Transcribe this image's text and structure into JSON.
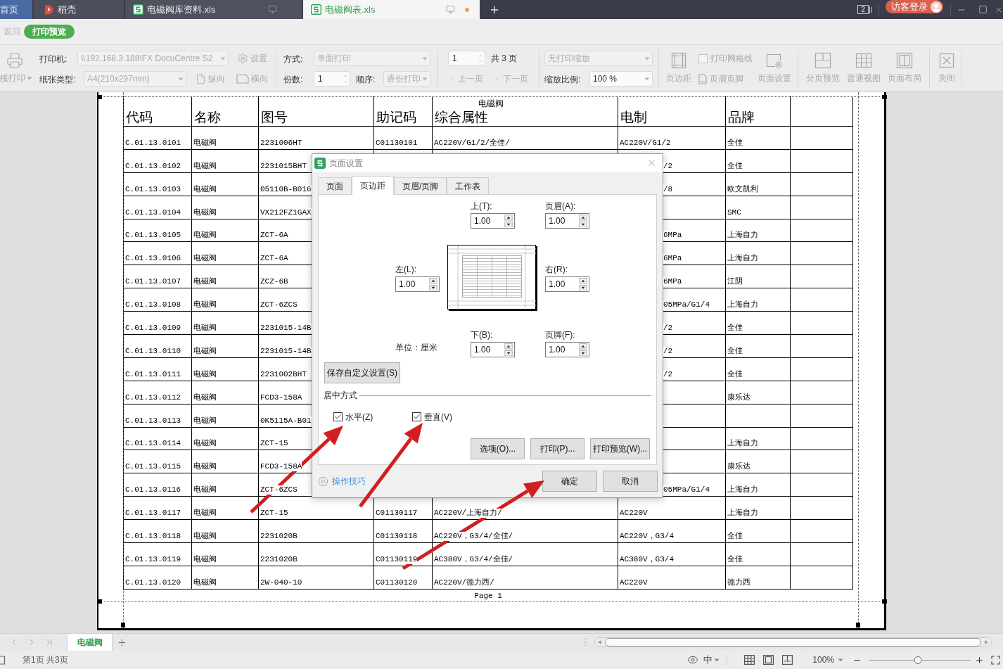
{
  "tabs": [
    {
      "label": "首页",
      "kind": "home",
      "selected": false
    },
    {
      "label": "稻壳",
      "kind": "docer",
      "selected": false
    },
    {
      "label": "电磁阀库资料.xls",
      "kind": "sheet",
      "selected": false,
      "unsaved": false
    },
    {
      "label": "电磁阀表.xls",
      "kind": "sheet",
      "selected": true,
      "unsaved": true
    }
  ],
  "title_bar": {
    "window_count": "2",
    "login_button": "访客登录"
  },
  "mode_bar": {
    "back": {
      "label": "返回",
      "disabled": true
    },
    "mode": "打印预览"
  },
  "toolbar": {
    "direct_print": {
      "label": "接打印",
      "disabled": true
    },
    "printer": {
      "label": "打印机:",
      "value": "\\\\192.168.3.188\\FX DocuCentre S2",
      "disabled": true
    },
    "printer_settings": {
      "label": "设置",
      "disabled": true
    },
    "paper": {
      "label": "纸张类型:",
      "value": "A4(210x297mm)",
      "disabled": true
    },
    "orientation": [
      {
        "label": "纵向",
        "kind": "portrait",
        "disabled": true
      },
      {
        "label": "横向",
        "kind": "landscape",
        "disabled": true
      }
    ],
    "duplex": {
      "label": "方式:",
      "value": "单面打印",
      "disabled": true
    },
    "copies": {
      "label": "份数:",
      "value": "1",
      "disabled": false
    },
    "collate": {
      "label": "顺序:",
      "value": "逐份打印",
      "disabled": true
    },
    "page": {
      "value": "1",
      "total": "共 3 页",
      "disabled": false
    },
    "page_nav": [
      {
        "label": "上一页",
        "kind": "prev",
        "disabled": true
      },
      {
        "label": "下一页",
        "kind": "next",
        "disabled": true
      }
    ],
    "scaling": {
      "value": "无打印缩放",
      "disabled": true
    },
    "zoom": {
      "label": "缩放比例:",
      "value": "100 %",
      "disabled": false
    },
    "margins_button": {
      "label": "页边距",
      "disabled": true
    },
    "gridlines": {
      "label": "打印网格线",
      "checked": false,
      "disabled": true
    },
    "header_footer_button": {
      "label": "页眉页脚",
      "disabled": true
    },
    "page_setup_button": {
      "label": "页面设置",
      "disabled": true
    },
    "views": [
      {
        "label": "分页预览",
        "kind": "page_break",
        "disabled": true
      },
      {
        "label": "普通视图",
        "kind": "normal",
        "disabled": true
      },
      {
        "label": "页面布局",
        "kind": "layout",
        "disabled": true
      }
    ],
    "close_button": {
      "label": "关闭",
      "disabled": true
    }
  },
  "page": {
    "header": "电磁阀",
    "footer": "Page 1",
    "columns": [
      "代码",
      "名称",
      "图号",
      "助记码",
      "综合属性",
      "电制",
      "品牌"
    ],
    "rows": [
      {
        "code": "C.01.13.0101",
        "name": "电磁阀",
        "part_no": "2231006HT",
        "mnemonic": "C01130101",
        "properties": "AC220V/G1/2/全佳/",
        "power": "AC220V/G1/2",
        "brand": "全佳"
      },
      {
        "code": "C.01.13.0102",
        "name": "电磁阀",
        "part_no": "2231015BHT",
        "power": "/2",
        "brand": "全佳"
      },
      {
        "code": "C.01.13.0103",
        "name": "电磁阀",
        "part_no": "05110B-B016",
        "power": "/8",
        "brand": "欧文凯利"
      },
      {
        "code": "C.01.13.0104",
        "name": "电磁阀",
        "part_no": "VX212FZ1GAX",
        "brand": "SMC"
      },
      {
        "code": "C.01.13.0105",
        "name": "电磁阀",
        "part_no": "ZCT-6A",
        "power": "6MPa",
        "brand": "上海自力"
      },
      {
        "code": "C.01.13.0106",
        "name": "电磁阀",
        "part_no": "ZCT-6A",
        "power": "6MPa",
        "brand": "上海自力"
      },
      {
        "code": "C.01.13.0107",
        "name": "电磁阀",
        "part_no": "ZCZ-6B",
        "power": "6MPa",
        "brand": "江阴"
      },
      {
        "code": "C.01.13.0108",
        "name": "电磁阀",
        "part_no": "ZCT-6ZCS",
        "power": "05MPa/G1/4",
        "brand": "上海自力"
      },
      {
        "code": "C.01.13.0109",
        "name": "电磁阀",
        "part_no": "2231015-14B",
        "power": "/2",
        "brand": "全佳"
      },
      {
        "code": "C.01.13.0110",
        "name": "电磁阀",
        "part_no": "2231015-14B",
        "power": "/2",
        "brand": "全佳"
      },
      {
        "code": "C.01.13.0111",
        "name": "电磁阀",
        "part_no": "2231002BHT",
        "power": "/2",
        "brand": "全佳"
      },
      {
        "code": "C.01.13.0112",
        "name": "电磁阀",
        "part_no": "FCD3-158A",
        "brand": "康乐达"
      },
      {
        "code": "C.01.13.0113",
        "name": "电磁阀",
        "part_no": "0K5115A-B01"
      },
      {
        "code": "C.01.13.0114",
        "name": "电磁阀",
        "part_no": "ZCT-15",
        "brand": "上海自力"
      },
      {
        "code": "C.01.13.0115",
        "name": "电磁阀",
        "part_no": "FCD3-158A",
        "brand": "康乐达"
      },
      {
        "code": "C.01.13.0116",
        "name": "电磁阀",
        "part_no": "ZCT-6ZCS",
        "power": "05MPa/G1/4",
        "brand": "上海自力"
      },
      {
        "code": "C.01.13.0117",
        "name": "电磁阀",
        "part_no": "ZCT-15",
        "mnemonic": "C01130117",
        "properties": "AC220V/上海自力/",
        "power": "AC220V",
        "brand": "上海自力"
      },
      {
        "code": "C.01.13.0118",
        "name": "电磁阀",
        "part_no": "2231020B",
        "mnemonic": "C01130118",
        "properties": "AC220V，G3/4/全佳/",
        "power": "AC220V，G3/4",
        "brand": "全佳"
      },
      {
        "code": "C.01.13.0119",
        "name": "电磁阀",
        "part_no": "2231020B",
        "mnemonic": "C01130119",
        "properties": "AC380V，G3/4/全佳/",
        "power": "AC380V，G3/4",
        "brand": "全佳"
      },
      {
        "code": "C.01.13.0120",
        "name": "电磁阀",
        "part_no": "2W-040-10",
        "mnemonic": "C01130120",
        "properties": "AC220V/德力西/",
        "power": "AC220V",
        "brand": "德力西"
      }
    ]
  },
  "dialog": {
    "title": "页面设置",
    "tabs": [
      {
        "label": "页面",
        "selected": false
      },
      {
        "label": "页边距",
        "selected": true
      },
      {
        "label": "页眉/页脚",
        "selected": false
      },
      {
        "label": "工作表",
        "selected": false
      }
    ],
    "margins": [
      {
        "label": "上(T):",
        "value": "1.00"
      },
      {
        "label": "页眉(A):",
        "value": "1.00"
      },
      {
        "label": "左(L):",
        "value": "1.00"
      },
      {
        "label": "右(R):",
        "value": "1.00"
      },
      {
        "label": "下(B):",
        "value": "1.00"
      },
      {
        "label": "页脚(F):",
        "value": "1.00"
      }
    ],
    "unit": "单位：厘米",
    "save_button": "保存自定义设置(S)",
    "center_group": "居中方式",
    "center_options": [
      {
        "label": "水平(Z)",
        "checked": true
      },
      {
        "label": "垂直(V)",
        "checked": true
      }
    ],
    "option_buttons": [
      "选项(O)...",
      "打印(P)...",
      "打印预览(W)..."
    ],
    "tips_link": "操作技巧",
    "buttons": [
      "确定",
      "取消"
    ]
  },
  "sheet_bar": {
    "sheets": [
      {
        "label": "电磁阀",
        "selected": true
      }
    ]
  },
  "status_bar": {
    "page_info": "第1页 共3页",
    "input_mode": "中",
    "zoom": "100%",
    "zoom_slider": {
      "level": 0.48
    }
  }
}
